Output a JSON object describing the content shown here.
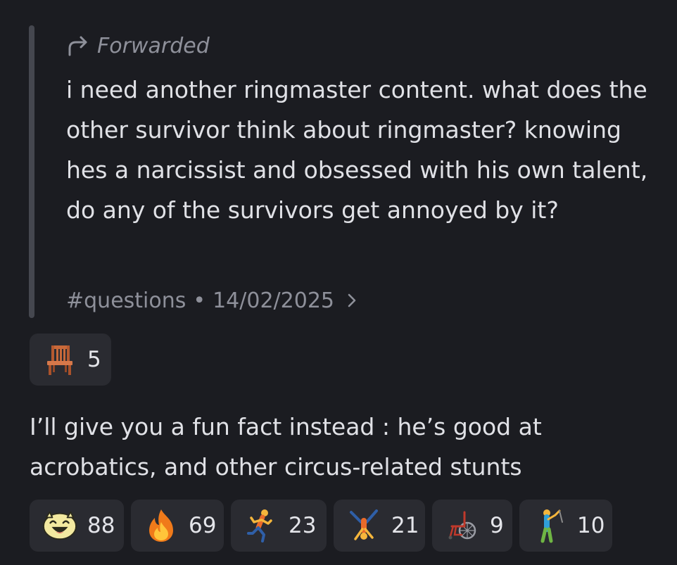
{
  "forwarded": {
    "label": "Forwarded",
    "icon": "forward-arrow-icon",
    "text": "i need another ringmaster content. what does the other survivor think about ringmaster? knowing hes a narcissist and obsessed with his own talent, do any of the survivors get annoyed by it?",
    "channel": "#questions",
    "separator": "•",
    "date": "14/02/2025",
    "chevron_icon": "chevron-right-icon"
  },
  "forward_reactions": [
    {
      "emoji": "chair-emoji",
      "count": "5"
    }
  ],
  "reply": {
    "text": "I’ll give you a fun fact instead : he’s good at acrobatics, and other circus-related stunts"
  },
  "reactions": [
    {
      "emoji": "happy-custom-emoji",
      "count": "88"
    },
    {
      "emoji": "fire-emoji",
      "count": "69"
    },
    {
      "emoji": "running-person-emoji",
      "count": "23"
    },
    {
      "emoji": "cartwheel-person-emoji",
      "count": "21"
    },
    {
      "emoji": "wheelchair-emoji",
      "count": "9"
    },
    {
      "emoji": "golfer-emoji",
      "count": "10"
    }
  ],
  "colors": {
    "background": "#1b1c21",
    "reaction_bg": "#2a2b31",
    "muted_text": "#8e909a",
    "main_text": "#e0e1e6",
    "quote_bar": "#45474f"
  }
}
